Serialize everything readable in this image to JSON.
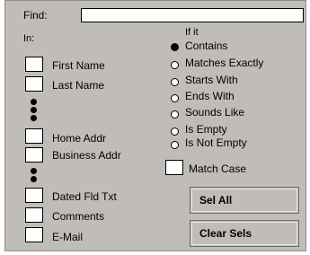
{
  "find": {
    "label": "Find:",
    "value": ""
  },
  "in_label": "In:",
  "if_label": "If it",
  "fields": {
    "first_name": {
      "label": "First Name",
      "checked": false
    },
    "last_name": {
      "label": "Last Name",
      "checked": false
    },
    "home_addr": {
      "label": "Home Addr",
      "checked": false
    },
    "business_addr": {
      "label": "Business Addr",
      "checked": false
    },
    "dated_fld_txt": {
      "label": "Dated Fld Txt",
      "checked": false
    },
    "comments": {
      "label": "Comments",
      "checked": false
    },
    "email": {
      "label": "E-Mail",
      "checked": false
    }
  },
  "conditions": {
    "contains": {
      "label": "Contains",
      "selected": true
    },
    "matches_exactly": {
      "label": "Matches Exactly",
      "selected": false
    },
    "starts_with": {
      "label": "Starts With",
      "selected": false
    },
    "ends_with": {
      "label": "Ends With",
      "selected": false
    },
    "sounds_like": {
      "label": "Sounds Like",
      "selected": false
    },
    "is_empty": {
      "label": "Is Empty",
      "selected": false
    },
    "is_not_empty": {
      "label": "Is Not Empty",
      "selected": false
    }
  },
  "match_case": {
    "label": "Match Case",
    "checked": false
  },
  "buttons": {
    "sel_all": "Sel All",
    "clear_sels": "Clear Sels"
  }
}
